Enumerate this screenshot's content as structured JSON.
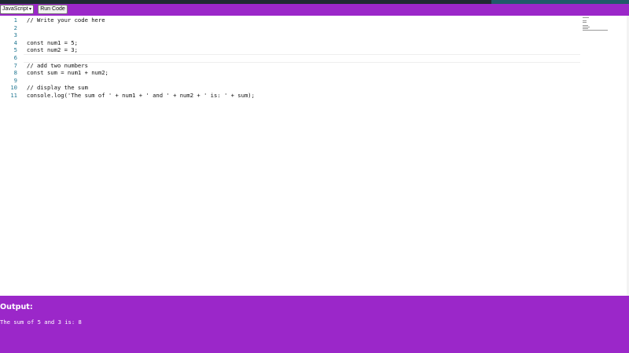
{
  "toolbar": {
    "language_selected": "JavaScript",
    "run_label": "Run Code"
  },
  "editor": {
    "line_numbers": [
      "1",
      "2",
      "3",
      "4",
      "5",
      "6",
      "7",
      "8",
      "9",
      "10",
      "11"
    ],
    "lines": [
      "// Write your code here",
      "",
      "",
      "const num1 = 5;",
      "const num2 = 3;",
      "",
      "// add two numbers",
      "const sum = num1 + num2;",
      "",
      "// display the sum",
      "console.log('The sum of ' + num1 + ' and ' + num2 + ' is: ' + sum);"
    ]
  },
  "output": {
    "title": "Output:",
    "text": "The sum of 5 and 3 is: 8"
  },
  "colors": {
    "accent": "#9b27c9",
    "line_number": "#237893",
    "top_strip": "#1f2a33"
  },
  "icons": {
    "select_arrow": "chevron-down-icon"
  }
}
